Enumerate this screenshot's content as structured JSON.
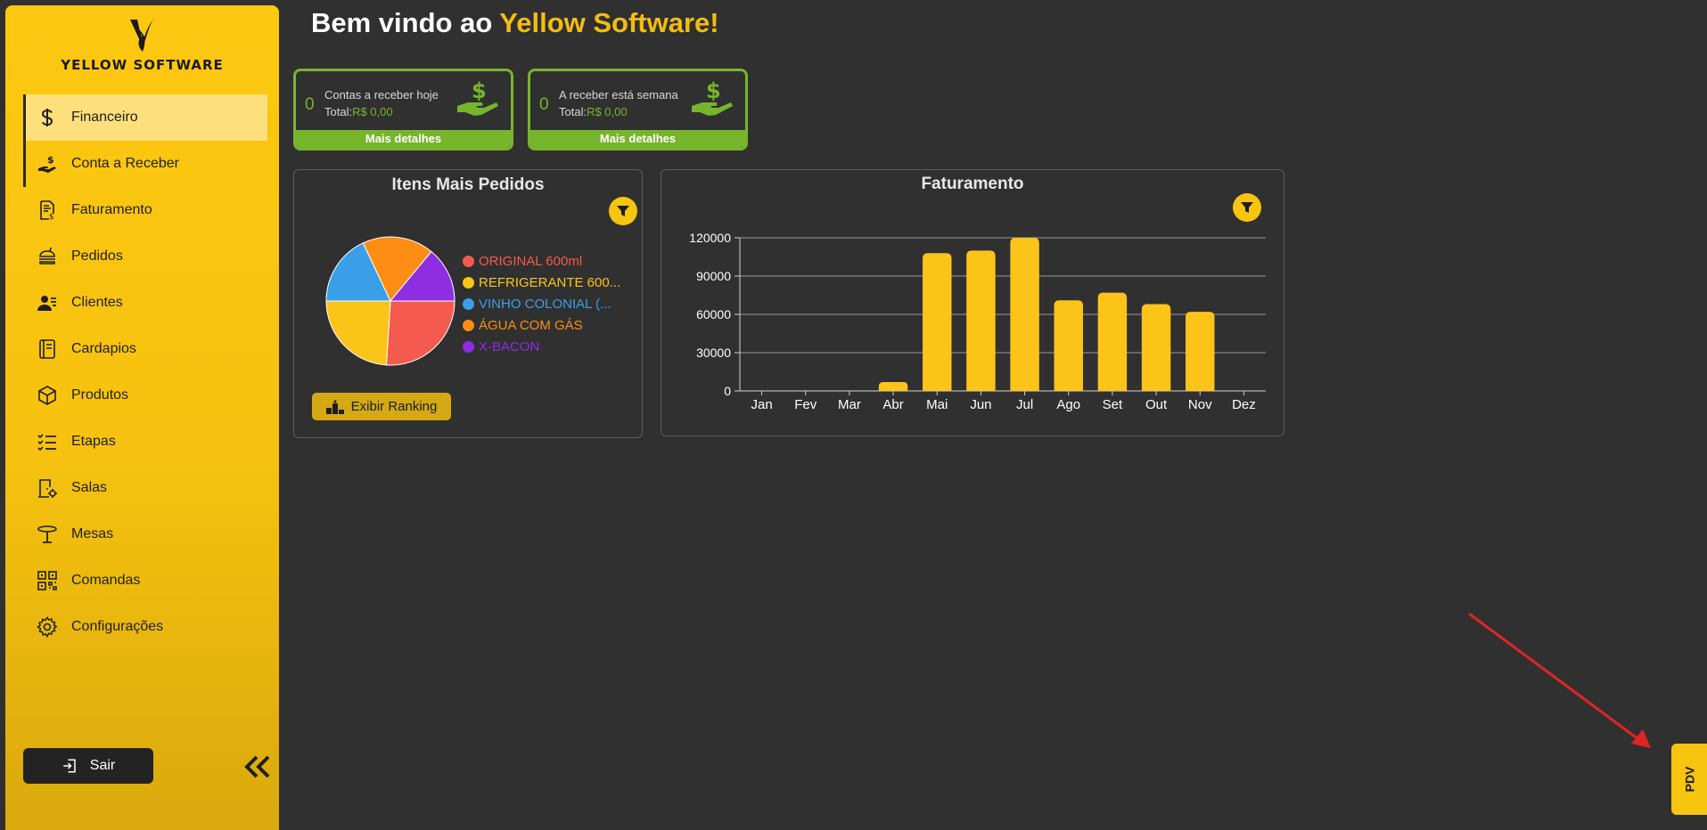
{
  "brand": {
    "name": "YELLOW SOFTWARE"
  },
  "sidebar": {
    "items": [
      {
        "label": "Financeiro",
        "icon": "dollar-icon"
      },
      {
        "label": "Conta a Receber",
        "icon": "hand-money-icon"
      },
      {
        "label": "Faturamento",
        "icon": "invoice-icon"
      },
      {
        "label": "Pedidos",
        "icon": "burger-icon"
      },
      {
        "label": "Clientes",
        "icon": "users-icon"
      },
      {
        "label": "Cardapios",
        "icon": "book-icon"
      },
      {
        "label": "Produtos",
        "icon": "box-icon"
      },
      {
        "label": "Etapas",
        "icon": "checklist-icon"
      },
      {
        "label": "Salas",
        "icon": "room-icon"
      },
      {
        "label": "Mesas",
        "icon": "table-icon"
      },
      {
        "label": "Comandas",
        "icon": "qrcode-icon"
      },
      {
        "label": "Configurações",
        "icon": "gear-icon"
      }
    ],
    "active_item": "Financeiro",
    "logout_label": "Sair"
  },
  "header": {
    "welcome_prefix": "Bem vindo ao",
    "welcome_brand": "Yellow Software!"
  },
  "cards": [
    {
      "count": "0",
      "label": "Contas a receber hoje",
      "total_label": "Total:",
      "total_value": "R$ 0,00",
      "details_label": "Mais detalhes"
    },
    {
      "count": "0",
      "label": "A receber está semana",
      "total_label": "Total:",
      "total_value": "R$ 0,00",
      "details_label": "Mais detalhes"
    }
  ],
  "pie_panel": {
    "title": "Itens Mais Pedidos",
    "ranking_button": "Exibir Ranking"
  },
  "bar_panel": {
    "title": "Faturamento"
  },
  "pdv_label": "PDV",
  "colors": {
    "accent": "#f7c40f",
    "success": "#77b52c",
    "background": "#303030"
  },
  "chart_data": [
    {
      "type": "pie",
      "title": "Itens Mais Pedidos",
      "labels": [
        "ORIGINAL 600ml",
        "REFRIGERANTE 600...",
        "VINHO COLONIAL (...",
        "ÁGUA COM GÁS",
        "X-BACON"
      ],
      "values": [
        26,
        24,
        18,
        18,
        14
      ],
      "colors": [
        "#f55a4e",
        "#fcc419",
        "#3a9fe8",
        "#fd8d14",
        "#8e2de2"
      ],
      "legend_position": "right"
    },
    {
      "type": "bar",
      "title": "Faturamento",
      "categories": [
        "Jan",
        "Fev",
        "Mar",
        "Abr",
        "Mai",
        "Jun",
        "Jul",
        "Ago",
        "Set",
        "Out",
        "Nov",
        "Dez"
      ],
      "values": [
        0,
        0,
        0,
        7000,
        108000,
        110000,
        120000,
        71000,
        77000,
        68000,
        62000,
        0
      ],
      "ylim": [
        0,
        120000
      ],
      "yticks": [
        "0",
        "30000",
        "60000",
        "90000",
        "120000"
      ],
      "grid": true,
      "bar_color": "#fcc419"
    }
  ]
}
